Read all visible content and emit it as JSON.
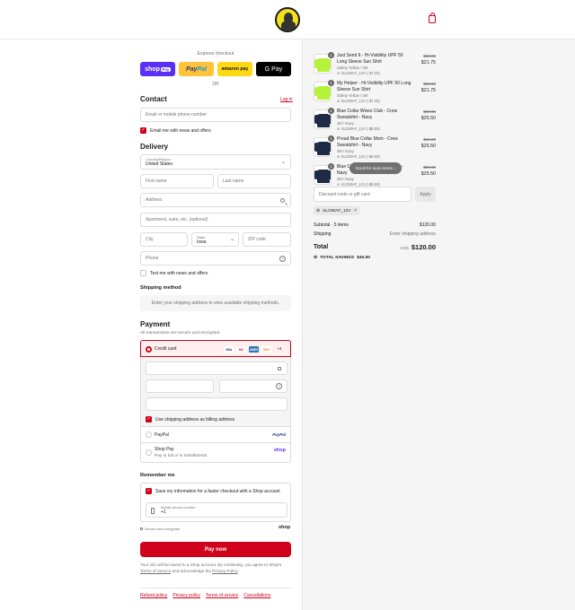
{
  "header": {
    "logo_name": "store-logo",
    "cart_icon": "shopping-bag-icon"
  },
  "express": {
    "label": "Express checkout",
    "shop_pay": "shop",
    "shop_pay_tag": "Pay",
    "paypal_a": "Pay",
    "paypal_b": "Pal",
    "amazon": "amazon pay",
    "gpay": "G Pay",
    "or": "OR"
  },
  "contact": {
    "heading": "Contact",
    "login": "Log in",
    "email_placeholder": "Email or mobile phone number",
    "news_label": "Email me with news and offers"
  },
  "delivery": {
    "heading": "Delivery",
    "country_label": "Country/Region",
    "country_value": "United States",
    "first_name": "First name",
    "last_name": "Last name",
    "address": "Address",
    "apartment": "Apartment, suite, etc. (optional)",
    "city": "City",
    "state_label": "State",
    "state_value": "Iowa",
    "zip": "ZIP code",
    "phone": "Phone",
    "text_label": "Text me with news and offers"
  },
  "shipping": {
    "heading": "Shipping method",
    "notice": "Enter your shipping address to view available shipping methods."
  },
  "payment": {
    "heading": "Payment",
    "sub": "All transactions are secure and encrypted.",
    "credit_card": "Credit card",
    "cards": [
      "VISA",
      "MC",
      "AMEX",
      "DISC"
    ],
    "more_cards": "+4",
    "billing_label": "Use shipping address as billing address",
    "paypal": "PayPal",
    "paypal_logo": "PayPal",
    "shop_pay": "Shop Pay",
    "shop_pay_sub": "Pay in full or in installments",
    "shop_logo": "shop"
  },
  "remember": {
    "heading": "Remember me",
    "save_label": "Save my information for a faster checkout with a Shop account",
    "mobile_label": "Mobile phone number",
    "mobile_value": "+1",
    "secure": "Secure and encrypted",
    "shop_logo": "shop"
  },
  "pay_now": "Pay now",
  "legal": {
    "text_a": "Your info will be saved to a Shop account. By continuing, you agree to Shop's",
    "tos": "Terms of Service",
    "text_b": " and acknowledge the ",
    "privacy": "Privacy Policy",
    "end": "."
  },
  "footer_links": [
    "Refund policy",
    "Privacy policy",
    "Terms of service",
    "Cancellations"
  ],
  "cart": {
    "items": [
      {
        "qty": "1",
        "title": "Just Send It - Hi-Visibility UPF 50 Long Sleeve Sun Shirt",
        "variant": "Safety Yellow / 3M",
        "discount": "SLOWAF_12V (-$7.25)",
        "old": "$28.99",
        "price": "$21.75",
        "color": "#b6f23a"
      },
      {
        "qty": "1",
        "title": "My Helper - Hi-Visibility UPF 50 Long Sleeve Sun Shirt",
        "variant": "Safety Yellow / 3M",
        "discount": "SLOWAF_12V (-$7.25)",
        "old": "$28.99",
        "price": "$21.75",
        "color": "#b6f23a"
      },
      {
        "qty": "1",
        "title": "Blue Collar Wives Club - Crew Sweatshirt - Navy",
        "variant": "3M / Navy",
        "discount": "SLOWAF_12V (-$8.50)",
        "old": "$34.00",
        "price": "$25.50",
        "color": "#1f2a44"
      },
      {
        "qty": "1",
        "title": "Proud Blue Collar Mom - Crew Sweatshirt - Navy",
        "variant": "3M / Navy",
        "discount": "SLOWAF_12V (-$8.50)",
        "old": "$34.00",
        "price": "$25.50",
        "color": "#1f2a44"
      },
      {
        "qty": "1",
        "title": "Blue Collar ... - Crew Sweatshirt - Navy",
        "variant": "3M / Navy",
        "discount": "SLOWAF_12V (-$8.50)",
        "old": "$34.00",
        "price": "$25.50",
        "color": "#1f2a44"
      }
    ],
    "scroll_hint": "Scroll for more items",
    "discount_placeholder": "Discount code or gift card",
    "apply": "Apply",
    "code": "SLOWAF_12V",
    "subtotal_label": "Subtotal · 5 items",
    "subtotal": "$120.00",
    "shipping_label": "Shipping",
    "shipping_value": "Enter shipping address",
    "total_label": "Total",
    "currency": "USD",
    "total": "$120.00",
    "savings_label": "TOTAL SAVINGS",
    "savings": "$40.00"
  }
}
